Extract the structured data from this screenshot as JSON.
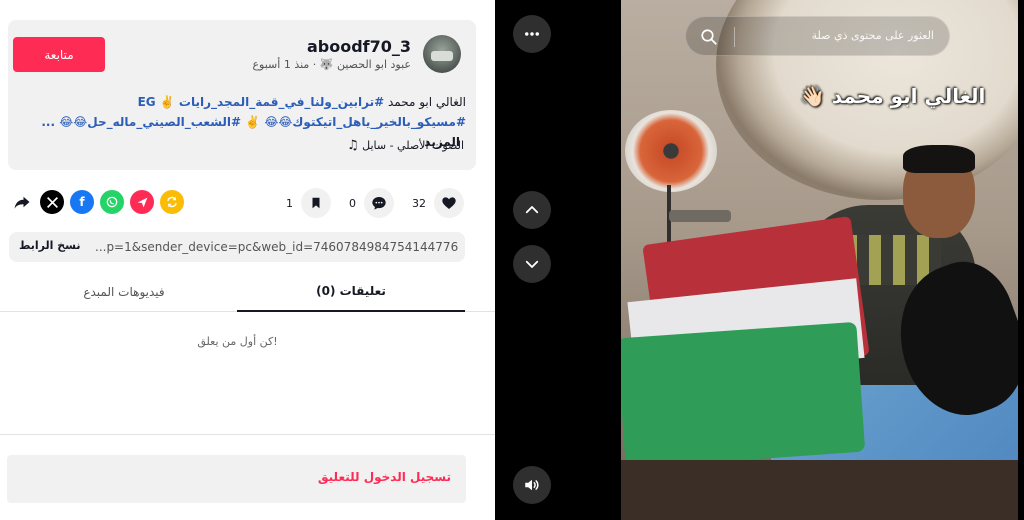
{
  "post": {
    "username": "aboodf70_3",
    "meta": "عبود ابو الحصين 🐺 · منذ 1 أسبوع",
    "follow_label": "متابعة",
    "desc_line1_prefix": "الغالي ابو محمد",
    "desc_line1_tags": "#ترابين_ولنا_في_قمة_المجد_رايات ✌️ EG",
    "desc_line2_tags": "#مسيكو_بالخير_ياهل_اتيكتوك😂😂 ✌️ #الشعب_الصيني_ماله_حل😂😂 ...",
    "more_label": "المزيد",
    "sound_label": "الصوت الأصلي - سايل"
  },
  "stats": {
    "likes": "32",
    "comments": "0",
    "saves": "1"
  },
  "share": {
    "link_text": "...p=1&sender_device=pc&web_id=7460784984754144776",
    "copy_label": "نسخ الرابط"
  },
  "tabs": {
    "comments_label": "(0) تعليقات",
    "creator_videos_label": "فيديوهات المبدع"
  },
  "comments": {
    "empty_message": "كن أول من يعلق!",
    "login_label": "تسجيل الدخول للتعليق"
  },
  "player": {
    "search_placeholder": "العثور على محتوى ذي صلة",
    "overlay_caption": "الغالي ابو محمد 👋🏻"
  },
  "colors": {
    "accent": "#fe2c55",
    "hashtag": "#2b5db9"
  },
  "icons": {
    "share_icons": [
      "arrow-share-icon",
      "x-icon",
      "facebook-icon",
      "whatsapp-icon",
      "send-icon",
      "repost-icon"
    ]
  }
}
